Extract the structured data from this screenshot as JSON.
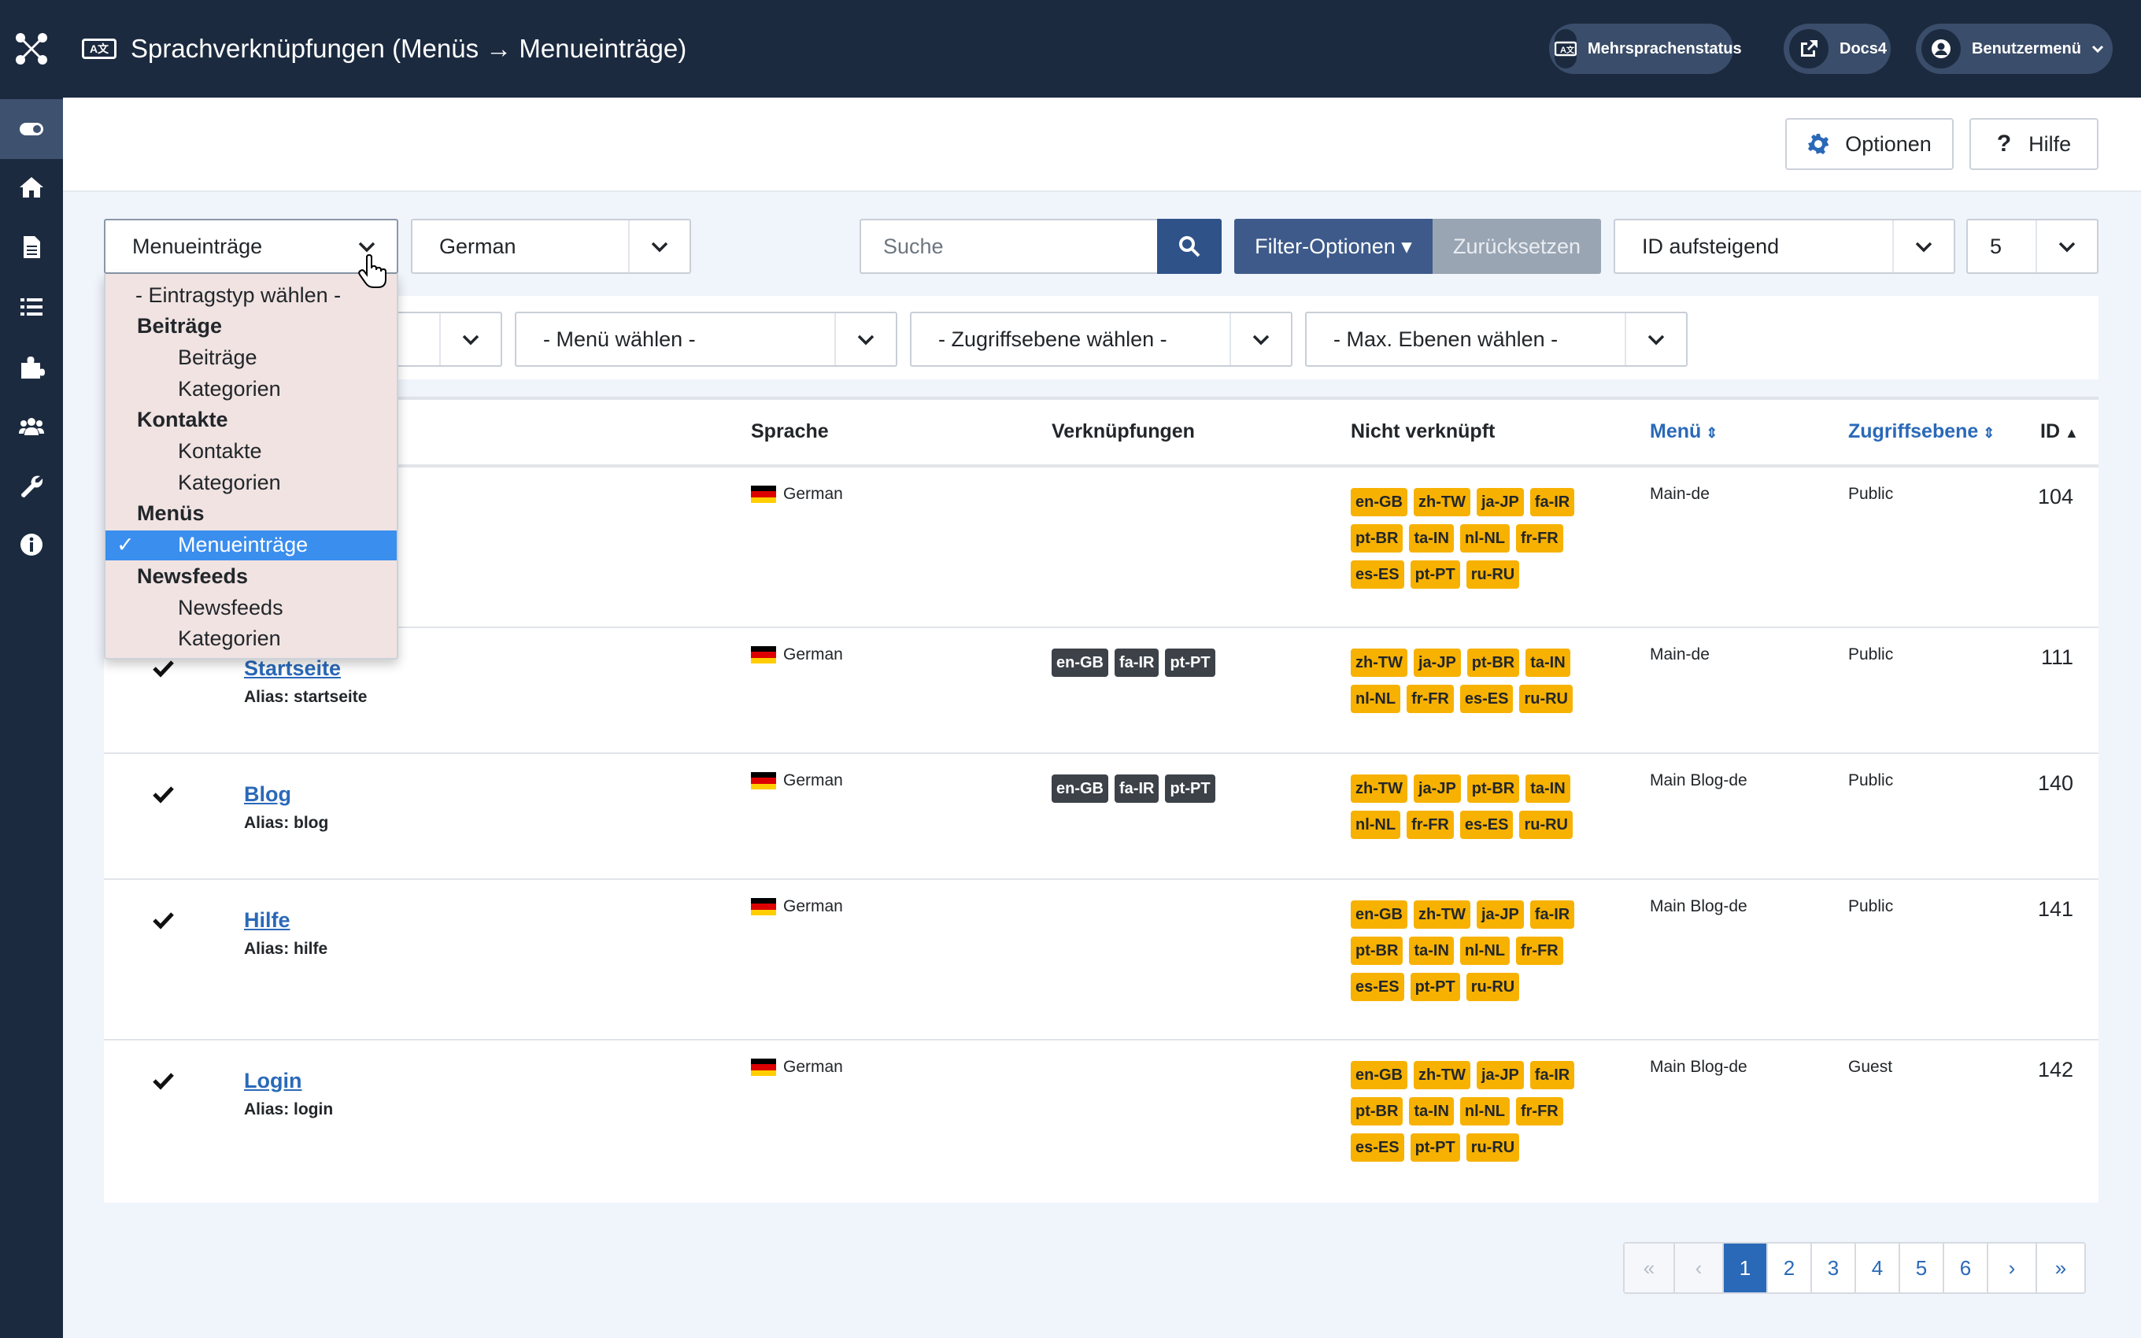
{
  "header": {
    "title": "Sprachverknüpfungen (Menüs → Menueinträge)",
    "title_icon": "language-icon",
    "buttons": [
      {
        "label": "Mehrsprachenstatus",
        "icon": "language-icon"
      },
      {
        "label": "Docs4",
        "icon": "external-link-icon"
      },
      {
        "label": "Benutzermenü",
        "icon": "user-icon"
      }
    ]
  },
  "toolbar": {
    "options_label": "Optionen",
    "help_label": "Hilfe"
  },
  "filters": {
    "type_select": "Menueinträge",
    "language_select": "German",
    "search_placeholder": "Suche",
    "filter_options_label": "Filter-Optionen ▾",
    "reset_label": "Zurücksetzen",
    "ordering_select": "ID aufsteigend",
    "limit_select": "5",
    "menu_select": "- Menü wählen -",
    "access_select": "- Zugriffsebene wählen -",
    "levels_select": "- Max. Ebenen wählen -"
  },
  "dropdown": {
    "items": [
      {
        "label": "- Eintragstyp wählen -",
        "kind": "option"
      },
      {
        "label": "Beiträge",
        "kind": "group"
      },
      {
        "label": "Beiträge",
        "kind": "child"
      },
      {
        "label": "Kategorien",
        "kind": "child"
      },
      {
        "label": "Kontakte",
        "kind": "group"
      },
      {
        "label": "Kontakte",
        "kind": "child"
      },
      {
        "label": "Kategorien",
        "kind": "child"
      },
      {
        "label": "Menüs",
        "kind": "group"
      },
      {
        "label": "Menueinträge",
        "kind": "selected"
      },
      {
        "label": "Newsfeeds",
        "kind": "group"
      },
      {
        "label": "Newsfeeds",
        "kind": "child"
      },
      {
        "label": "Kategorien",
        "kind": "child"
      }
    ],
    "check_mark": "✓"
  },
  "table": {
    "headers": {
      "language": "Sprache",
      "associations": "Verknüpfungen",
      "not_associated": "Nicht verknüpft",
      "menu": "Menü",
      "access": "Zugriffsebene",
      "id": "ID"
    },
    "rows": [
      {
        "title": "",
        "alias": "",
        "language": "German",
        "associations": [],
        "not_associated": [
          "en-GB",
          "zh-TW",
          "ja-JP",
          "fa-IR",
          "pt-BR",
          "ta-IN",
          "nl-NL",
          "fr-FR",
          "es-ES",
          "pt-PT",
          "ru-RU"
        ],
        "menu": "Main-de",
        "access": "Public",
        "id": "104"
      },
      {
        "title": "Startseite",
        "alias": "Alias: startseite",
        "language": "German",
        "associations": [
          "en-GB",
          "fa-IR",
          "pt-PT"
        ],
        "not_associated": [
          "zh-TW",
          "ja-JP",
          "pt-BR",
          "ta-IN",
          "nl-NL",
          "fr-FR",
          "es-ES",
          "ru-RU"
        ],
        "menu": "Main-de",
        "access": "Public",
        "id": "111"
      },
      {
        "title": "Blog",
        "alias": "Alias: blog",
        "language": "German",
        "associations": [
          "en-GB",
          "fa-IR",
          "pt-PT"
        ],
        "not_associated": [
          "zh-TW",
          "ja-JP",
          "pt-BR",
          "ta-IN",
          "nl-NL",
          "fr-FR",
          "es-ES",
          "ru-RU"
        ],
        "menu": "Main Blog-de",
        "access": "Public",
        "id": "140"
      },
      {
        "title": "Hilfe",
        "alias": "Alias: hilfe",
        "language": "German",
        "associations": [],
        "not_associated": [
          "en-GB",
          "zh-TW",
          "ja-JP",
          "fa-IR",
          "pt-BR",
          "ta-IN",
          "nl-NL",
          "fr-FR",
          "es-ES",
          "pt-PT",
          "ru-RU"
        ],
        "menu": "Main Blog-de",
        "access": "Public",
        "id": "141"
      },
      {
        "title": "Login",
        "alias": "Alias: login",
        "language": "German",
        "associations": [],
        "not_associated": [
          "en-GB",
          "zh-TW",
          "ja-JP",
          "fa-IR",
          "pt-BR",
          "ta-IN",
          "nl-NL",
          "fr-FR",
          "es-ES",
          "pt-PT",
          "ru-RU"
        ],
        "menu": "Main Blog-de",
        "access": "Guest",
        "id": "142"
      }
    ]
  },
  "pagination": {
    "pages": [
      "1",
      "2",
      "3",
      "4",
      "5",
      "6"
    ],
    "current": "1",
    "first": "«",
    "prev": "‹",
    "next": "›",
    "last": "»"
  },
  "colors": {
    "sidebar": "#1c2a3f",
    "primary": "#2a69b8",
    "badge_warning": "#f7b100",
    "badge_dark": "#3d4249",
    "dropdown_bg": "#f0e3e2",
    "dropdown_selected": "#3a8eee"
  }
}
